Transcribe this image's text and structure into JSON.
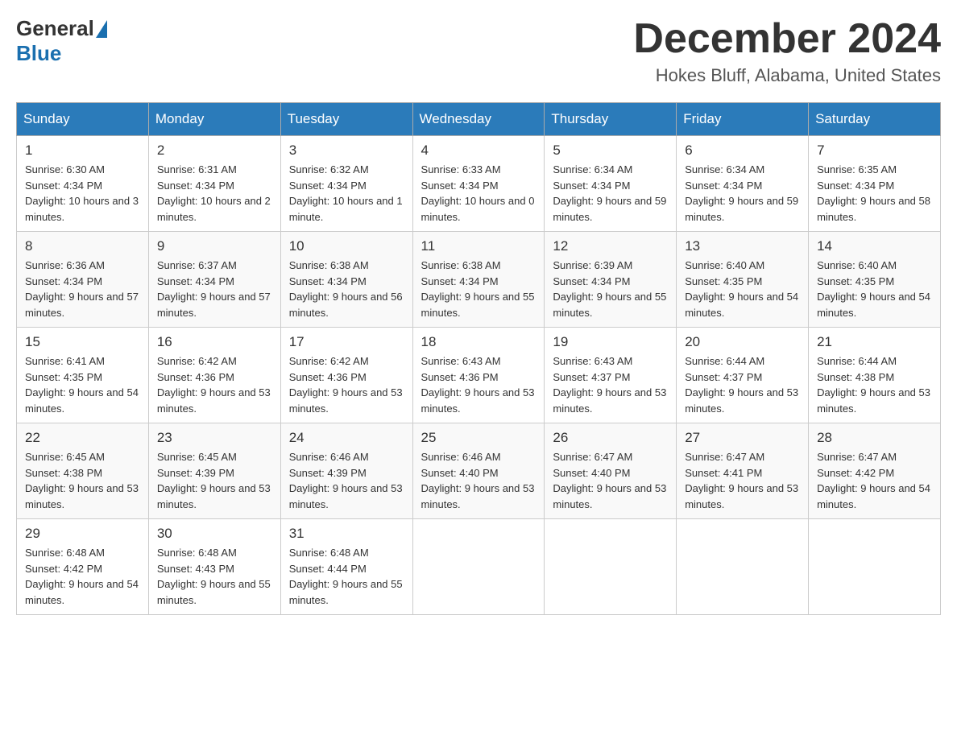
{
  "header": {
    "logo_general": "General",
    "logo_blue": "Blue",
    "month_title": "December 2024",
    "location": "Hokes Bluff, Alabama, United States"
  },
  "days_of_week": [
    "Sunday",
    "Monday",
    "Tuesday",
    "Wednesday",
    "Thursday",
    "Friday",
    "Saturday"
  ],
  "weeks": [
    [
      {
        "day": "1",
        "sunrise": "6:30 AM",
        "sunset": "4:34 PM",
        "daylight": "10 hours and 3 minutes."
      },
      {
        "day": "2",
        "sunrise": "6:31 AM",
        "sunset": "4:34 PM",
        "daylight": "10 hours and 2 minutes."
      },
      {
        "day": "3",
        "sunrise": "6:32 AM",
        "sunset": "4:34 PM",
        "daylight": "10 hours and 1 minute."
      },
      {
        "day": "4",
        "sunrise": "6:33 AM",
        "sunset": "4:34 PM",
        "daylight": "10 hours and 0 minutes."
      },
      {
        "day": "5",
        "sunrise": "6:34 AM",
        "sunset": "4:34 PM",
        "daylight": "9 hours and 59 minutes."
      },
      {
        "day": "6",
        "sunrise": "6:34 AM",
        "sunset": "4:34 PM",
        "daylight": "9 hours and 59 minutes."
      },
      {
        "day": "7",
        "sunrise": "6:35 AM",
        "sunset": "4:34 PM",
        "daylight": "9 hours and 58 minutes."
      }
    ],
    [
      {
        "day": "8",
        "sunrise": "6:36 AM",
        "sunset": "4:34 PM",
        "daylight": "9 hours and 57 minutes."
      },
      {
        "day": "9",
        "sunrise": "6:37 AM",
        "sunset": "4:34 PM",
        "daylight": "9 hours and 57 minutes."
      },
      {
        "day": "10",
        "sunrise": "6:38 AM",
        "sunset": "4:34 PM",
        "daylight": "9 hours and 56 minutes."
      },
      {
        "day": "11",
        "sunrise": "6:38 AM",
        "sunset": "4:34 PM",
        "daylight": "9 hours and 55 minutes."
      },
      {
        "day": "12",
        "sunrise": "6:39 AM",
        "sunset": "4:34 PM",
        "daylight": "9 hours and 55 minutes."
      },
      {
        "day": "13",
        "sunrise": "6:40 AM",
        "sunset": "4:35 PM",
        "daylight": "9 hours and 54 minutes."
      },
      {
        "day": "14",
        "sunrise": "6:40 AM",
        "sunset": "4:35 PM",
        "daylight": "9 hours and 54 minutes."
      }
    ],
    [
      {
        "day": "15",
        "sunrise": "6:41 AM",
        "sunset": "4:35 PM",
        "daylight": "9 hours and 54 minutes."
      },
      {
        "day": "16",
        "sunrise": "6:42 AM",
        "sunset": "4:36 PM",
        "daylight": "9 hours and 53 minutes."
      },
      {
        "day": "17",
        "sunrise": "6:42 AM",
        "sunset": "4:36 PM",
        "daylight": "9 hours and 53 minutes."
      },
      {
        "day": "18",
        "sunrise": "6:43 AM",
        "sunset": "4:36 PM",
        "daylight": "9 hours and 53 minutes."
      },
      {
        "day": "19",
        "sunrise": "6:43 AM",
        "sunset": "4:37 PM",
        "daylight": "9 hours and 53 minutes."
      },
      {
        "day": "20",
        "sunrise": "6:44 AM",
        "sunset": "4:37 PM",
        "daylight": "9 hours and 53 minutes."
      },
      {
        "day": "21",
        "sunrise": "6:44 AM",
        "sunset": "4:38 PM",
        "daylight": "9 hours and 53 minutes."
      }
    ],
    [
      {
        "day": "22",
        "sunrise": "6:45 AM",
        "sunset": "4:38 PM",
        "daylight": "9 hours and 53 minutes."
      },
      {
        "day": "23",
        "sunrise": "6:45 AM",
        "sunset": "4:39 PM",
        "daylight": "9 hours and 53 minutes."
      },
      {
        "day": "24",
        "sunrise": "6:46 AM",
        "sunset": "4:39 PM",
        "daylight": "9 hours and 53 minutes."
      },
      {
        "day": "25",
        "sunrise": "6:46 AM",
        "sunset": "4:40 PM",
        "daylight": "9 hours and 53 minutes."
      },
      {
        "day": "26",
        "sunrise": "6:47 AM",
        "sunset": "4:40 PM",
        "daylight": "9 hours and 53 minutes."
      },
      {
        "day": "27",
        "sunrise": "6:47 AM",
        "sunset": "4:41 PM",
        "daylight": "9 hours and 53 minutes."
      },
      {
        "day": "28",
        "sunrise": "6:47 AM",
        "sunset": "4:42 PM",
        "daylight": "9 hours and 54 minutes."
      }
    ],
    [
      {
        "day": "29",
        "sunrise": "6:48 AM",
        "sunset": "4:42 PM",
        "daylight": "9 hours and 54 minutes."
      },
      {
        "day": "30",
        "sunrise": "6:48 AM",
        "sunset": "4:43 PM",
        "daylight": "9 hours and 55 minutes."
      },
      {
        "day": "31",
        "sunrise": "6:48 AM",
        "sunset": "4:44 PM",
        "daylight": "9 hours and 55 minutes."
      },
      null,
      null,
      null,
      null
    ]
  ]
}
